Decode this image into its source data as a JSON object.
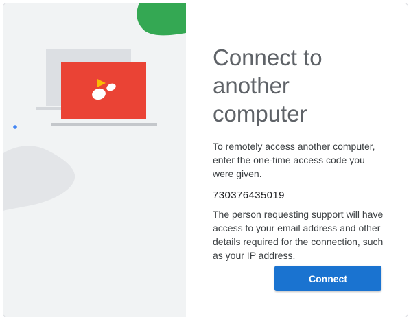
{
  "dialog": {
    "title": "Connect to another computer",
    "description": "To remotely access another computer, enter the one-time access code you were given.",
    "access_code": {
      "value": "730376435019"
    },
    "notice": "The person requesting support will have access to your email address and other details required for the connection, such as your IP address.",
    "connect_label": "Connect"
  },
  "illustration": {
    "icon": "remote-desktop-laptop-icon",
    "colors": {
      "screen": "#ea4335",
      "accent": "#fbbc04",
      "blob": "#34a853",
      "dot": "#4285f4"
    }
  },
  "colors": {
    "button": "#1a73d0",
    "input_underline": "#5f8fd6",
    "left_panel": "#f1f3f4"
  }
}
